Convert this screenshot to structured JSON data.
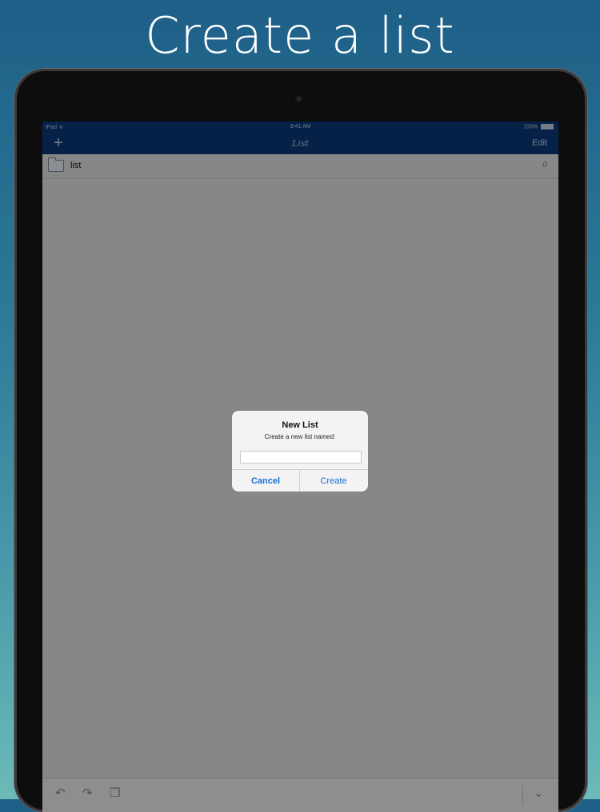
{
  "headline": "Create a list",
  "status_bar": {
    "device": "iPad",
    "time": "9:41 AM",
    "battery": "100%"
  },
  "nav": {
    "add_icon": "plus-icon",
    "title": "List",
    "edit_label": "Edit"
  },
  "list_rows": [
    {
      "icon": "folder-icon",
      "label": "list",
      "count": "0"
    }
  ],
  "toolbar": {
    "icons": [
      "undo-icon",
      "redo-icon",
      "copy-icon",
      "chevron-down-icon"
    ]
  },
  "dialog": {
    "title": "New List",
    "message": "Create a new list named:",
    "input_value": "",
    "input_placeholder": "",
    "cancel_label": "Cancel",
    "create_label": "Create"
  },
  "colors": {
    "nav_bar": "#0b3a7a",
    "accent_button": "#1a6fd4",
    "background_top": "#1e5f87",
    "background_bottom": "#6cbab8"
  }
}
